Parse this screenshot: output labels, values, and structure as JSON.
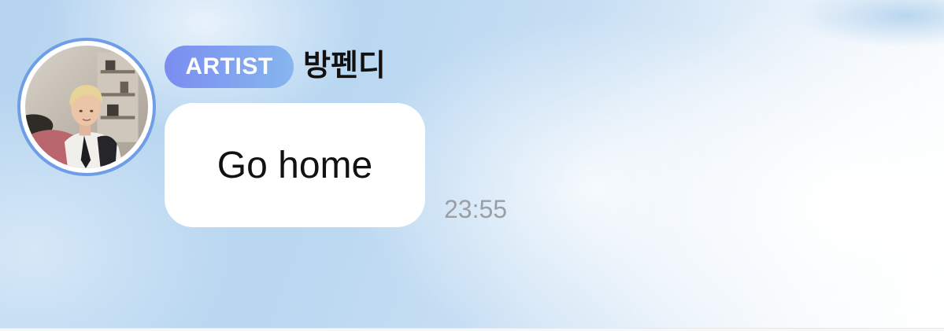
{
  "message": {
    "role_badge": "ARTIST",
    "sender_name": "방펜디",
    "text": "Go home",
    "time": "23:55"
  },
  "colors": {
    "badge_gradient_start": "#7b8df0",
    "badge_gradient_end": "#86b6ef",
    "avatar_ring": "#6f9ee6",
    "bubble": "#ffffff",
    "timestamp": "#9a9fa5",
    "background": "#b9d7f1"
  },
  "icons": {
    "avatar": "profile-photo"
  }
}
